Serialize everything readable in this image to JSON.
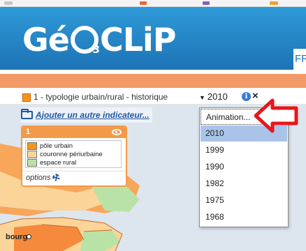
{
  "app": {
    "logo_text": "GéO3CLIP",
    "header_nav_partial": "FR"
  },
  "indicator": {
    "label": "1 - typologie urbain/rural - historique",
    "selected_year": "2010",
    "color": "#f7941d"
  },
  "add_indicator_link": "Ajouter un autre indicateur...",
  "legend": {
    "number": "1",
    "items": [
      {
        "label": "pôle urbain",
        "color": "#f7941d"
      },
      {
        "label": "couronne périurbaine",
        "color": "#fbd49a"
      },
      {
        "label": "espace rural",
        "color": "#b9e3a6"
      }
    ],
    "options_label": "options"
  },
  "year_dropdown": {
    "items": [
      "Animation...",
      "2010",
      "1999",
      "1990",
      "1982",
      "1975",
      "1968"
    ],
    "selected": "2010"
  },
  "map": {
    "city_label": "bourg"
  },
  "icons": [
    "folder-icon",
    "eye-icon",
    "info-icon",
    "close-icon",
    "wrench-icon",
    "caret-down-icon",
    "arrow-icon"
  ],
  "colors": {
    "header_blue": "#1d73b5",
    "accent_orange": "#f39a4a",
    "arrow_red": "#e8161b",
    "selected_row": "#a9c4e8"
  }
}
